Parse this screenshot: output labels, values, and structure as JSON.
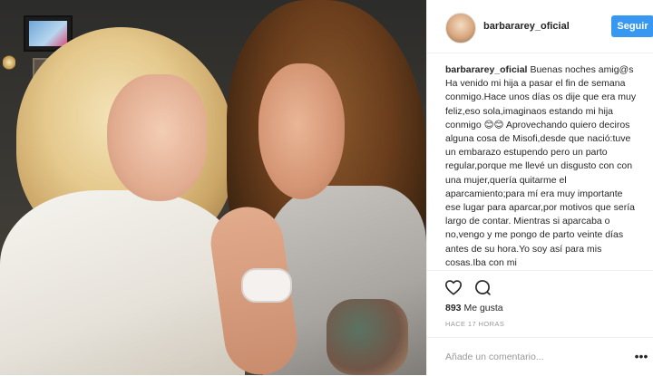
{
  "post": {
    "username": "barbararey_oficial",
    "follow_label": "Seguir",
    "caption_user": "barbararey_oficial",
    "caption_text": "Buenas noches amig@s Ha venido mi hija a pasar el fin de semana conmigo.Hace unos días os dije que era muy feliz,eso sola,imaginaos estando mi hija conmigo 😊😊 Aprovechando quiero deciros alguna cosa de Misofi,desde que nació:tuve un embarazo estupendo pero un parto regular,porque me llevé un disgusto con con una mujer,quería quitarme el aparcamiento;para mí era muy importante ese lugar para aparcar,por motivos que sería largo de contar. Mientras si aparcaba o no,vengo y me pongo de parto veinte días antes de su hora.Yo soy así para mis cosas.Iba con mi",
    "likes_count": "893",
    "likes_label": "Me gusta",
    "timestamp": "HACE 17 HORAS",
    "comment_placeholder": "Añade un comentario...",
    "more_symbol": "•••"
  },
  "icons": {
    "like": "heart-icon",
    "comment": "comment-icon",
    "more": "more-options-icon"
  },
  "colors": {
    "follow_button": "#3897f0",
    "text": "#262626",
    "muted": "#999999",
    "divider": "#efefef"
  }
}
